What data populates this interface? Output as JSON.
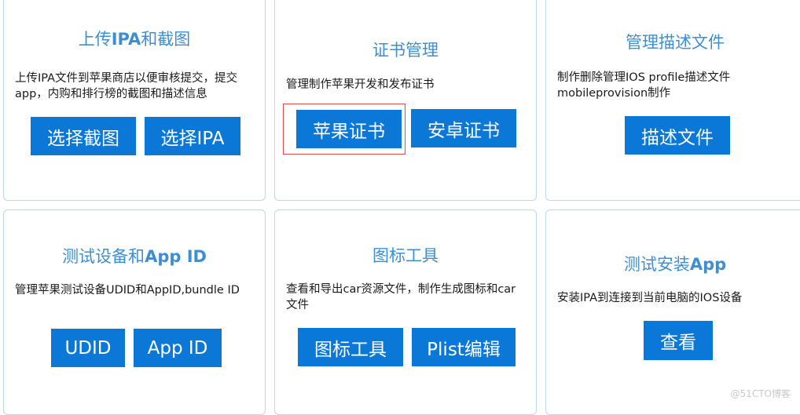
{
  "cards": {
    "upload_ipa": {
      "title_plain": "上传",
      "title_bold": "IPA",
      "title_suffix": "和截图",
      "description": "上传IPA文件到苹果商店以便审核提交，提交app，内购和排行榜的截图和描述信息",
      "buttons": [
        "选择截图",
        "选择IPA"
      ]
    },
    "cert_management": {
      "title": "证书管理",
      "description": "管理制作苹果开发和发布证书",
      "buttons": [
        "苹果证书",
        "安卓证书"
      ]
    },
    "profile_management": {
      "title": "管理描述文件",
      "description": "制作删除管理IOS profile描述文件mobileprovision制作",
      "buttons": [
        "描述文件"
      ]
    },
    "test_devices": {
      "title_plain": "测试设备和",
      "title_bold": "App ID",
      "description": "管理苹果测试设备UDID和AppID,bundle ID",
      "buttons": [
        "UDID",
        "App ID"
      ]
    },
    "icon_tools": {
      "title": "图标工具",
      "description": "查看和导出car资源文件，制作生成图标和car文件",
      "buttons": [
        "图标工具",
        "Plist编辑"
      ]
    },
    "test_install": {
      "title_plain": "测试安装",
      "title_bold": "App",
      "description": "安装IPA到连接到当前电脑的IOS设备",
      "buttons": [
        "查看"
      ]
    }
  },
  "watermark": "@51CTO博客",
  "colors": {
    "title_blue": "#3d8fd1",
    "button_blue": "#0b78d7",
    "card_border": "#bcd8ea",
    "highlight_red": "#dd4a4a"
  }
}
